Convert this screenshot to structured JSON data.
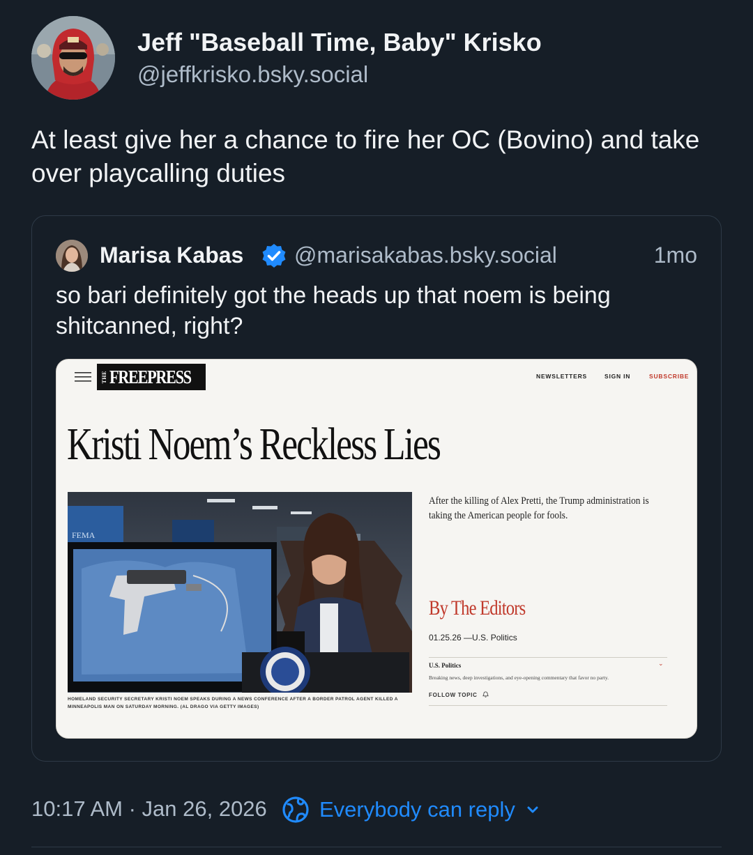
{
  "author": {
    "display_name": "Jeff \"Baseball Time, Baby\" Krisko",
    "handle": "@jeffkrisko.bsky.social"
  },
  "post": {
    "text": "At least give her a chance to fire her OC (Bovino) and take over playcalling duties",
    "timestamp": "10:17 AM · Jan 26, 2026",
    "reply_setting": "Everybody can reply"
  },
  "quote": {
    "display_name": "Marisa Kabas",
    "handle": "@marisakabas.bsky.social",
    "age": "1mo",
    "verified": true,
    "text": "so bari definitely got the heads up that noem is being shitcanned, right?"
  },
  "embed": {
    "logo_the": "THE",
    "logo_word": "FREEPRESS",
    "nav": {
      "newsletters": "NEWSLETTERS",
      "sign_in": "SIGN IN",
      "subscribe": "SUBSCRIBE"
    },
    "headline": "Kristi Noem’s Reckless Lies",
    "dek": "After the killing of Alex Pretti, the Trump administration is taking the American people for fools.",
    "byline": "By The Editors",
    "dateline": "01.25.26 —U.S. Politics",
    "topic": "U.S. Politics",
    "topic_desc": "Breaking news, deep investigations, and eye-opening commentary that favor no party.",
    "follow": "FOLLOW TOPIC",
    "caption": "HOMELAND SECURITY SECRETARY KRISTI NOEM SPEAKS DURING A NEWS CONFERENCE AFTER A BORDER PATROL AGENT KILLED A MINNEAPOLIS MAN ON SATURDAY MORNING. (AL DRAGO VIA GETTY IMAGES)",
    "photo_fema": "FEMA"
  },
  "colors": {
    "background": "#161e27",
    "accent": "#208bfe",
    "muted_text": "#aebbc9",
    "freepress_red": "#c0392b"
  },
  "icons": {
    "verified": "verified-check-icon",
    "reply_setting": "globe-reply-icon",
    "chevron": "chevron-down-icon",
    "menu": "hamburger-menu-icon",
    "bell": "bell-icon"
  }
}
